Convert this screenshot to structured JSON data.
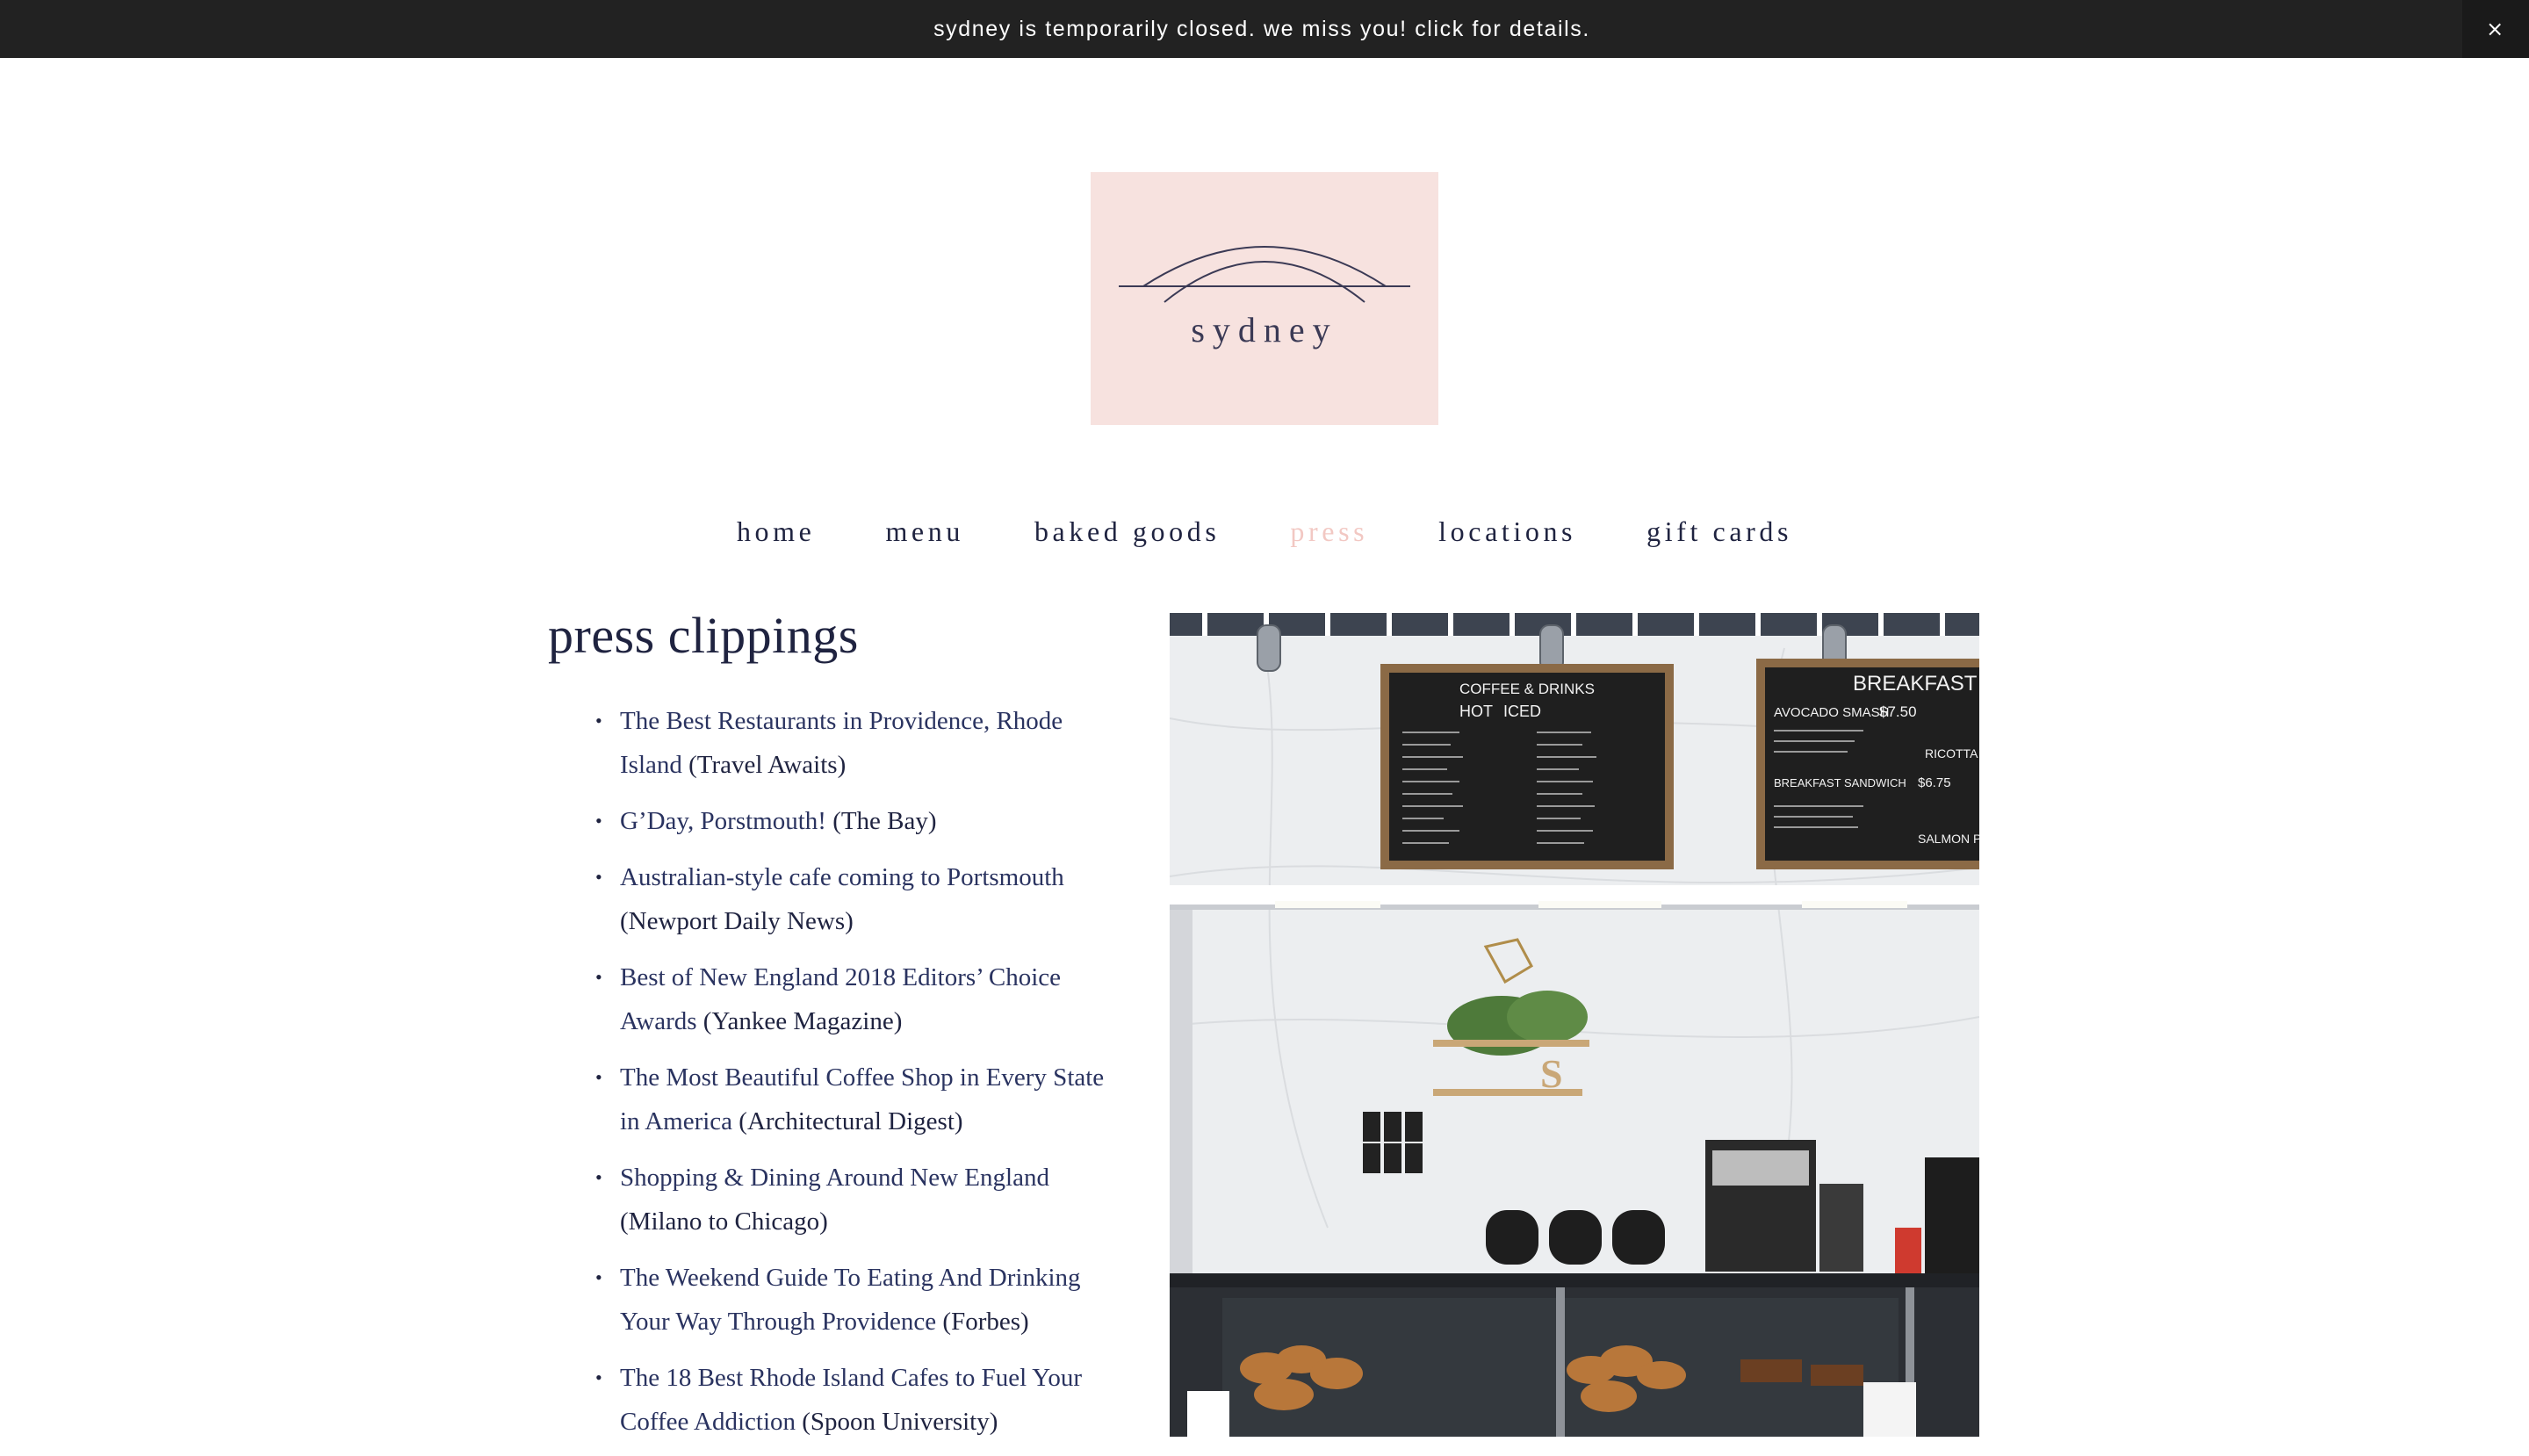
{
  "announcement": {
    "text": "sydney is temporarily closed. we miss you! click for details.",
    "close_label": "×"
  },
  "logo": {
    "wordmark": "sydney"
  },
  "nav": {
    "items": [
      {
        "label": "home"
      },
      {
        "label": "menu"
      },
      {
        "label": "baked goods"
      },
      {
        "label": "press",
        "active": true
      },
      {
        "label": "locations"
      },
      {
        "label": "gift cards"
      }
    ]
  },
  "page": {
    "title": "press clippings"
  },
  "clippings": [
    {
      "link": "The Best Restaurants in Providence, Rhode Island",
      "source": " (Travel Awaits)"
    },
    {
      "link": "G’Day, Porstmouth!",
      "source": " (The Bay)"
    },
    {
      "link": "Australian-style cafe coming to Portsmouth",
      "source": " (Newport Daily News)"
    },
    {
      "link": "Best of New England 2018 Editors’ Choice Awards",
      "source": " (Yankee Magazine)"
    },
    {
      "link": "The Most Beautiful Coffee Shop in Every State in America",
      "source": " (Architectural Digest)"
    },
    {
      "link": "Shopping & Dining Around New England",
      "source": " (Milano to Chicago)"
    },
    {
      "link": "The Weekend Guide To Eating And Drinking Your Way Through Providence",
      "source": " (Forbes)"
    },
    {
      "link": "The 18 Best Rhode Island Cafes to Fuel Your Coffee Addiction",
      "source": " (Spoon University)"
    }
  ],
  "photo": {
    "board_left": {
      "title": "COFFEE & DRINKS",
      "col_hot": "HOT",
      "col_iced": "ICED"
    },
    "board_right": {
      "title": "BREAKFAST",
      "item1": "AVOCADO SMASH",
      "price1": "$7.50",
      "item2": "BREAKFAST SANDWICH",
      "price2": "$6.75",
      "item3": "RICOTTA TO",
      "item4": "SALMON PLATT"
    },
    "shelf_letter": "S"
  },
  "colors": {
    "announcement_bg": "#222222",
    "logo_bg": "#f7e2df",
    "nav_active": "#f2c8c3",
    "text_navy": "#1f2340"
  }
}
